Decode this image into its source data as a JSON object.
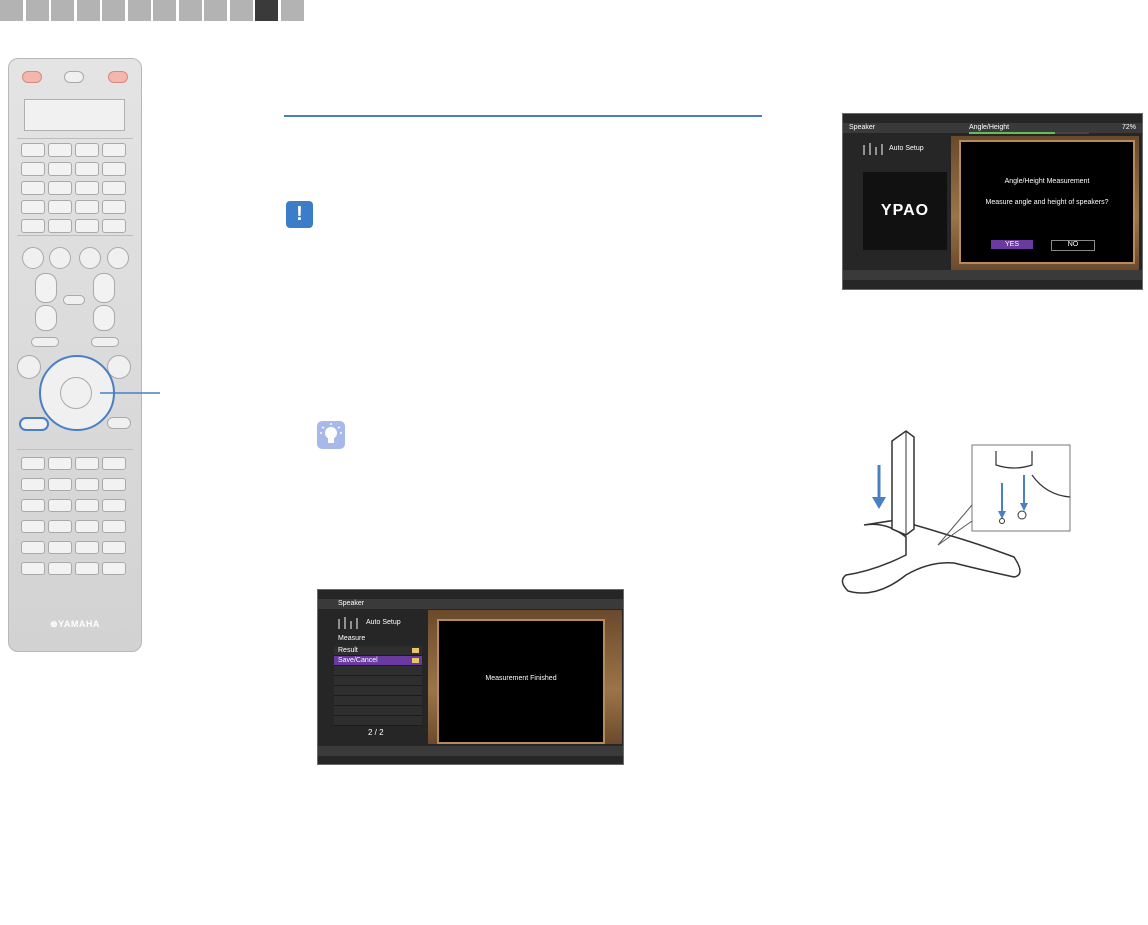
{
  "progress_tabs": {
    "count": 12,
    "active_index": 10
  },
  "remote": {
    "brand": "⊛YAMAHA"
  },
  "screen_result": {
    "header": "Speaker",
    "menu_title": "Auto Setup",
    "section": "Measure",
    "items": [
      {
        "label": "Result",
        "icon": "folder-icon",
        "selected": false
      },
      {
        "label": "Save/Cancel",
        "icon": "folder-icon",
        "selected": true
      }
    ],
    "page": "2 / 2",
    "message": "Measurement Finished"
  },
  "screen_angle": {
    "header": "Speaker",
    "progress_label": "Angle/Height",
    "progress_percent_text": "72%",
    "progress_value": 0.72,
    "menu_title": "Auto Setup",
    "logo": "YPAO",
    "dialog_title": "Angle/Height Measurement",
    "dialog_text": "Measure angle and height of speakers?",
    "yes_label": "YES",
    "no_label": "NO"
  },
  "colors": {
    "accent": "#4a7fc4",
    "selected": "#6a3aa0",
    "tab": "#b3b3b3",
    "tab_active": "#3a3a3a"
  }
}
